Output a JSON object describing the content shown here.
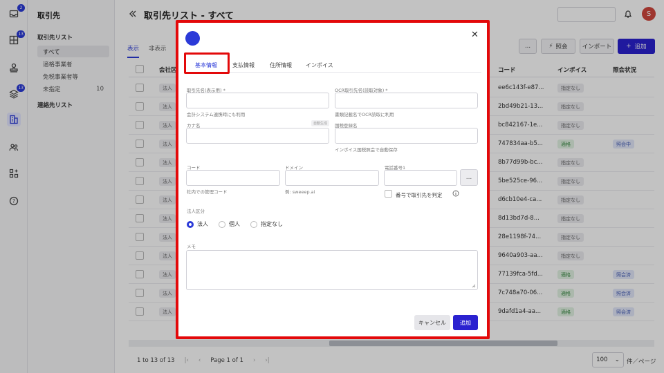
{
  "rail": {
    "badge_inbox": "2",
    "badge_grid": "13",
    "badge_layers": "13"
  },
  "subnav": {
    "title": "取引先",
    "section1": "取引先リスト",
    "items": [
      {
        "label": "すべて",
        "count": ""
      },
      {
        "label": "適格事業者",
        "count": ""
      },
      {
        "label": "免税事業者等",
        "count": ""
      },
      {
        "label": "未指定",
        "count": "10"
      }
    ],
    "section2": "連絡先リスト"
  },
  "header": {
    "title": "取引先リスト - すべて",
    "avatar": "S"
  },
  "view_tabs": [
    "表示",
    "非表示"
  ],
  "toolbar": {
    "dots": "...",
    "inquiry": "照会",
    "import": "インポート",
    "add": "追加"
  },
  "table": {
    "columns": {
      "company": "会社区",
      "code": "コード",
      "invoice": "インボイス",
      "status": "照会状況"
    },
    "rows": [
      {
        "type": "法人",
        "code": "ee6c143f-e87...",
        "invoice": "指定なし",
        "invoice_kind": "gray",
        "status": ""
      },
      {
        "type": "法人",
        "code": "2bd49b21-13...",
        "invoice": "指定なし",
        "invoice_kind": "gray",
        "status": ""
      },
      {
        "type": "法人",
        "code": "bc842167-1e...",
        "invoice": "指定なし",
        "invoice_kind": "gray",
        "status": ""
      },
      {
        "type": "法人",
        "code": "747834aa-b5...",
        "invoice": "適格",
        "invoice_kind": "green",
        "status": "照会中"
      },
      {
        "type": "法人",
        "code": "8b77d99b-bc...",
        "invoice": "指定なし",
        "invoice_kind": "gray",
        "status": ""
      },
      {
        "type": "法人",
        "code": "5be525ce-96...",
        "invoice": "指定なし",
        "invoice_kind": "gray",
        "status": ""
      },
      {
        "type": "法人",
        "code": "d6cb10e4-ca...",
        "invoice": "指定なし",
        "invoice_kind": "gray",
        "status": ""
      },
      {
        "type": "法人",
        "code": "8d13bd7d-8...",
        "invoice": "指定なし",
        "invoice_kind": "gray",
        "status": ""
      },
      {
        "type": "法人",
        "code": "28e1198f-74...",
        "invoice": "指定なし",
        "invoice_kind": "gray",
        "status": ""
      },
      {
        "type": "法人",
        "code": "9640a903-aa...",
        "invoice": "指定なし",
        "invoice_kind": "gray",
        "status": ""
      },
      {
        "type": "法人",
        "code": "77139fca-5fd...",
        "invoice": "適格",
        "invoice_kind": "green",
        "status": "照会済"
      },
      {
        "type": "法人",
        "code": "7c748a70-06...",
        "invoice": "適格",
        "invoice_kind": "green",
        "status": "照会済"
      },
      {
        "type": "法人",
        "code": "9dafd1a4-aa...",
        "invoice": "適格",
        "invoice_kind": "green",
        "status": "照会済"
      }
    ]
  },
  "pager": {
    "range": "1 to 13 of 13",
    "page_label": "Page 1 of 1",
    "per_page": "100",
    "per_page_suffix": "件／ページ"
  },
  "dialog": {
    "tabs": [
      "基本情報",
      "支払情報",
      "住所情報",
      "インボイス"
    ],
    "fields": {
      "display_name_label": "取引先名(表示用) *",
      "display_name_hint": "会計システム連携時にも利用",
      "ocr_name_label": "OCR取引先名(読取対象) *",
      "ocr_name_hint": "書類記載名でOCR読取に利用",
      "kana_label": "カナ名",
      "kana_mini": "自動生成",
      "tax_name_label": "国税登録名",
      "tax_name_hint": "インボイス国税照会で自動保存",
      "code_label": "コード",
      "code_hint": "社内での管理コード",
      "domain_label": "ドメイン",
      "domain_hint": "例: sweeep.ai",
      "phone_label": "電話番号1",
      "phone_dots": "...",
      "phone_check_label": "番号で取引先を判定",
      "entity_label": "法人区分",
      "entity_options": [
        "法人",
        "個人",
        "指定なし"
      ],
      "memo_label": "メモ"
    },
    "cancel": "キャンセル",
    "add": "追加"
  }
}
